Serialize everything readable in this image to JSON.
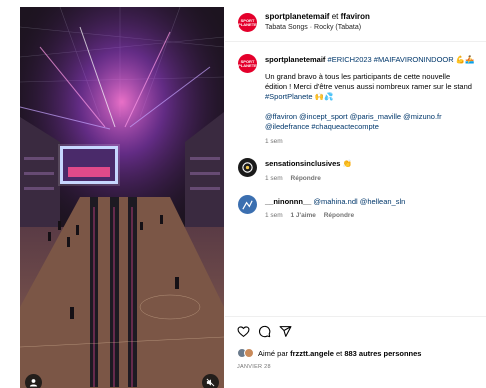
{
  "header": {
    "username": "sportplanetemaif",
    "conjunction": "et",
    "coauthor": "ffaviron",
    "audio": "Tabata Songs · Rocky (Tabata)",
    "avatar_text": "SPORT PLANETE"
  },
  "caption": {
    "username": "sportplanetemaif",
    "hashtags": "#ERICH2023 #MAIFAVIRONINDOOR 💪🚣",
    "lines": [
      "Un grand bravo à tous les participants de cette nouvelle",
      "édition ! Merci d'être venus aussi nombreux ramer sur le stand"
    ],
    "tag_line": "#SportPlanete 🙌💦",
    "mentions": [
      "@ffaviron @incept_sport @paris_maville @mizuno.fr",
      "@iledefrance #chaqueactecompte"
    ],
    "time": "1 sem"
  },
  "comments": [
    {
      "username": "sensationsinclusives",
      "text": "👏",
      "time": "1 sem",
      "reply_label": "Répondre",
      "likes_label": ""
    },
    {
      "username": "__ninonnn__",
      "text": "@mahina.ndl @hellean_sln",
      "time": "1 sem",
      "likes_label": "1 J'aime",
      "reply_label": "Répondre"
    }
  ],
  "likes": {
    "prefix": "Aimé par",
    "user": "frzztt.angele",
    "middle": "et",
    "others": "883 autres personnes"
  },
  "date": "JANVIER 28",
  "icons": [
    "heart-icon",
    "comment-icon",
    "share-icon",
    "user-tag-icon",
    "mute-icon"
  ]
}
